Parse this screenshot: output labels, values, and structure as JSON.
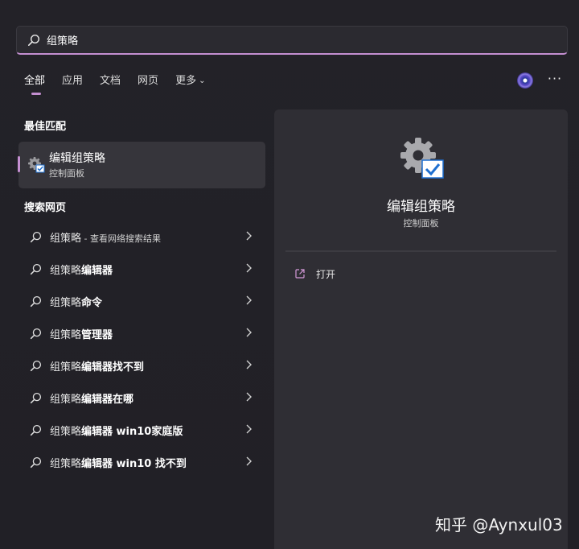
{
  "search": {
    "value": "组策略",
    "icon": "search-icon"
  },
  "tabs": [
    {
      "label": "全部",
      "active": true
    },
    {
      "label": "应用",
      "active": false
    },
    {
      "label": "文档",
      "active": false
    },
    {
      "label": "网页",
      "active": false
    },
    {
      "label": "更多",
      "active": false,
      "has_dropdown": true
    }
  ],
  "header_icons": {
    "avatar": "avatar-icon",
    "more": "more-options-icon",
    "more_text": "···"
  },
  "best_match": {
    "heading": "最佳匹配",
    "name": "编辑组策略",
    "subtitle": "控制面板",
    "icon": "gear-checkbox-icon"
  },
  "web_search": {
    "heading": "搜索网页",
    "items": [
      {
        "plain": "组策略",
        "bold": "",
        "suffix": " - 查看网络搜索结果"
      },
      {
        "plain": "组策略",
        "bold": "编辑器",
        "suffix": ""
      },
      {
        "plain": "组策略",
        "bold": "命令",
        "suffix": ""
      },
      {
        "plain": "组策略",
        "bold": "管理器",
        "suffix": ""
      },
      {
        "plain": "组策略",
        "bold": "编辑器找不到",
        "suffix": ""
      },
      {
        "plain": "组策略",
        "bold": "编辑器在哪",
        "suffix": ""
      },
      {
        "plain": "组策略",
        "bold": "编辑器 win10家庭版",
        "suffix": ""
      },
      {
        "plain": "组策略",
        "bold": "编辑器 win10 找不到",
        "suffix": ""
      }
    ]
  },
  "preview": {
    "title": "编辑组策略",
    "subtitle": "控制面板",
    "open_label": "打开",
    "icon": "gear-checkbox-icon"
  },
  "watermark": "知乎 @Aynxul03",
  "colors": {
    "accent": "#c48fd1",
    "background": "#1f1e24",
    "panel": "#2f2e34",
    "selected": "#36353b"
  }
}
